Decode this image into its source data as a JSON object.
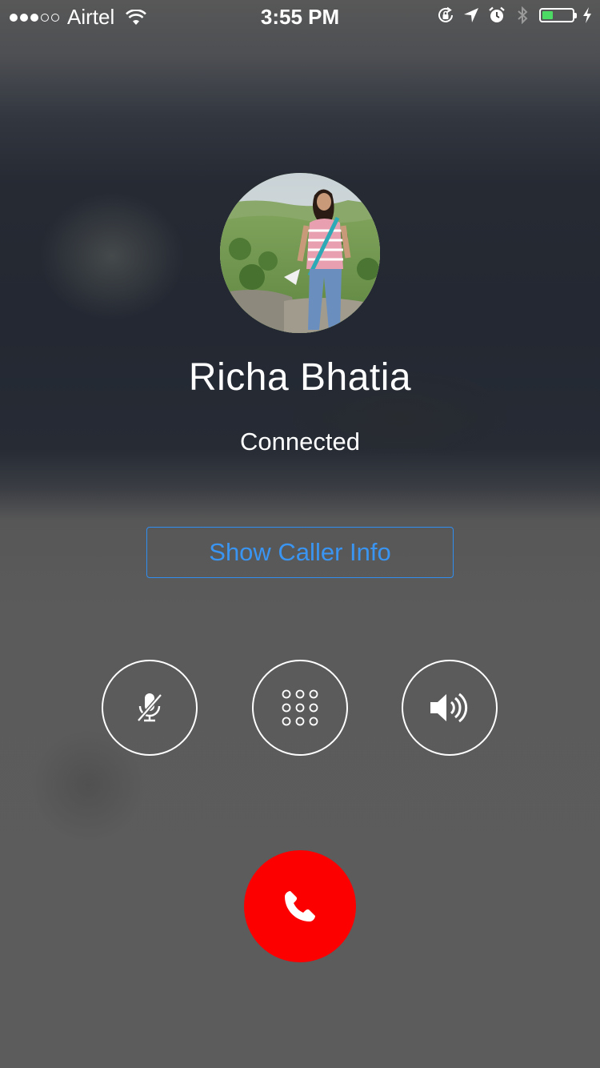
{
  "status_bar": {
    "signal_bars_filled": 3,
    "signal_bars_total": 5,
    "carrier": "Airtel",
    "time": "3:55 PM",
    "icons": [
      "wifi-icon",
      "orientation-lock-icon",
      "location-arrow-icon",
      "alarm-icon",
      "bluetooth-icon",
      "battery-icon",
      "charging-bolt-icon"
    ],
    "battery_level": 0.35,
    "battery_color": "#4cd964"
  },
  "call": {
    "avatar_icon": "caller-photo",
    "caller_name": "Richa Bhatia",
    "status": "Connected",
    "info_button_label": "Show Caller Info"
  },
  "controls": [
    {
      "name": "mute",
      "icon": "mute-microphone-icon"
    },
    {
      "name": "keypad",
      "icon": "keypad-icon"
    },
    {
      "name": "speaker",
      "icon": "speaker-icon"
    }
  ],
  "end_call": {
    "icon": "phone-handset-icon",
    "color": "#fc0000"
  },
  "colors": {
    "accent": "#3a95f2",
    "text": "#ffffff"
  }
}
